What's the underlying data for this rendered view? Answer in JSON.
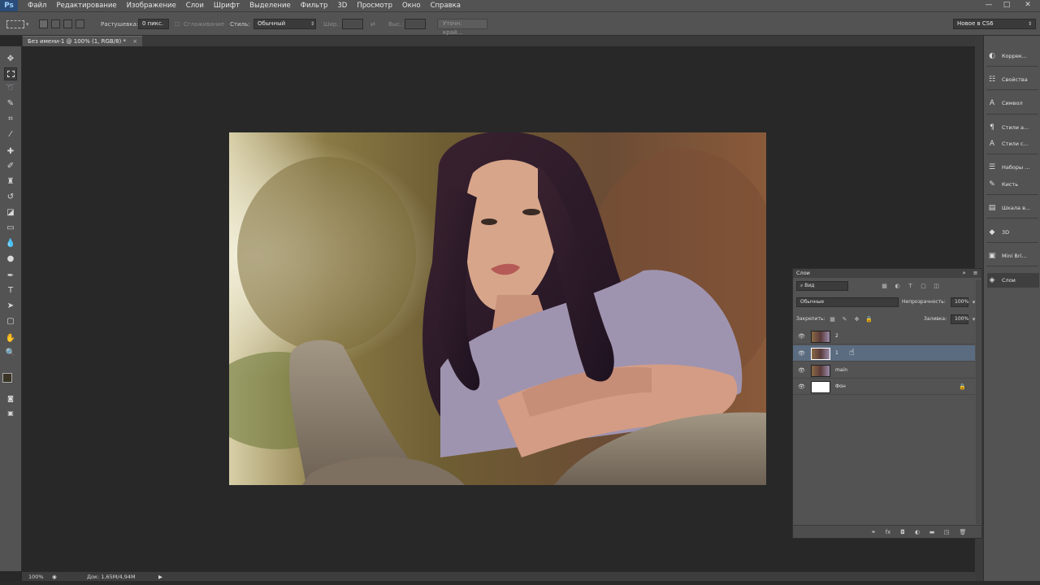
{
  "app": {
    "logo": "Ps"
  },
  "menu": [
    "Файл",
    "Редактирование",
    "Изображение",
    "Слои",
    "Шрифт",
    "Выделение",
    "Фильтр",
    "3D",
    "Просмотр",
    "Окно",
    "Справка"
  ],
  "window_controls": {
    "minimize": "—",
    "maximize": "□",
    "close": "✕"
  },
  "options_bar": {
    "feather_label": "Растушевка:",
    "feather_value": "0 пикс.",
    "antialias_label": "Сглаживание",
    "style_label": "Стиль:",
    "style_value": "Обычный",
    "width_label": "Шир.:",
    "height_label": "Выс.:",
    "refine_button": "Уточн. край...",
    "workspace_value": "Новое в CS6"
  },
  "document_tab": {
    "title": "Без имени-1 @ 100% (1, RGB/8) *",
    "close": "×"
  },
  "status_bar": {
    "zoom": "100%",
    "doc_info": "Док: 1,65M/4,94M",
    "arrow": "▶"
  },
  "dock": {
    "items": [
      {
        "label": "Коррек...",
        "icon": "adjustments-icon",
        "glyph": "◐"
      },
      {
        "label": "Свойства",
        "icon": "properties-icon",
        "glyph": "☷"
      },
      {
        "label": "Символ",
        "icon": "character-icon",
        "glyph": "A"
      },
      {
        "label": "Стили а...",
        "icon": "paragraph-styles-icon",
        "glyph": "¶"
      },
      {
        "label": "Стили с...",
        "icon": "character-styles-icon",
        "glyph": "A"
      },
      {
        "label": "Наборы ...",
        "icon": "brush-presets-icon",
        "glyph": "☰"
      },
      {
        "label": "Кисть",
        "icon": "brush-icon",
        "glyph": "✎"
      },
      {
        "label": "Шкала в...",
        "icon": "timeline-icon",
        "glyph": "▤"
      },
      {
        "label": "3D",
        "icon": "3d-icon",
        "glyph": "◆"
      },
      {
        "label": "Mini Bri...",
        "icon": "mini-bridge-icon",
        "glyph": "▣"
      },
      {
        "label": "Слои",
        "icon": "layers-icon",
        "glyph": "◈"
      }
    ]
  },
  "layers_panel": {
    "title": "Слои",
    "filter_kind": "Вид",
    "blend_mode": "Обычные",
    "opacity_label": "Непрозрачность:",
    "opacity_value": "100%",
    "lock_label": "Закрепить:",
    "fill_label": "Заливка:",
    "fill_value": "100%",
    "layers": [
      {
        "name": "2",
        "selected": false,
        "type": "photo"
      },
      {
        "name": "1",
        "selected": true,
        "type": "photo"
      },
      {
        "name": "main",
        "selected": false,
        "type": "photo"
      },
      {
        "name": "Фон",
        "selected": false,
        "type": "white",
        "locked": true
      }
    ]
  },
  "colors": {
    "chrome": "#535353",
    "canvas_bg": "#282828",
    "selected_layer": "#5b6c80",
    "foreground": "#3a3424",
    "background": "#ffffff"
  }
}
